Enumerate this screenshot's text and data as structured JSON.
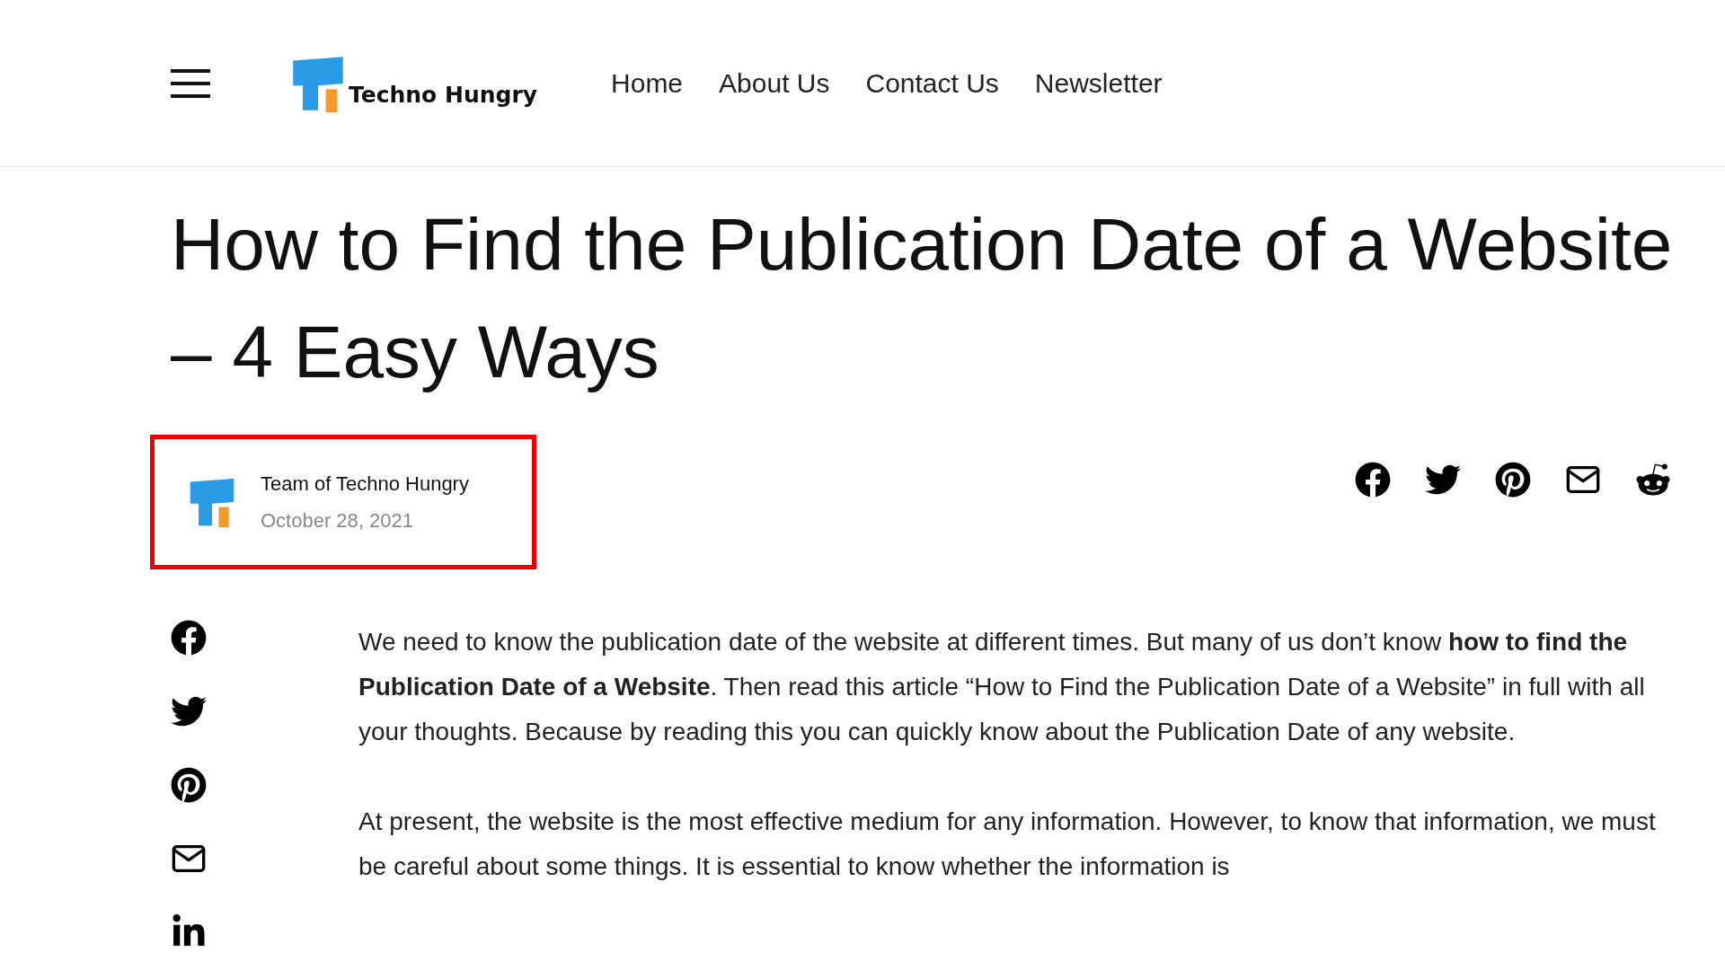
{
  "header": {
    "logo_text": "Techno Hungry",
    "nav": [
      "Home",
      "About Us",
      "Contact Us",
      "Newsletter"
    ]
  },
  "article": {
    "title": "How to Find the Publication Date of a Website – 4 Easy Ways",
    "author": {
      "name": "Team of Techno Hungry",
      "date": "October 28, 2021"
    },
    "paragraphs": [
      "We need to know the publication date of the website at different times. But many of us don’t know **how to find the Publication Date of a Website**. Then read this article “How to Find the Publication Date of a Website” in full with all your thoughts. Because by reading this you can quickly know about the Publication Date of any website.",
      "At present, the website is the most effective medium for any information. However, to know that information, we must be careful about some things. It is essential to know whether the information is"
    ]
  }
}
